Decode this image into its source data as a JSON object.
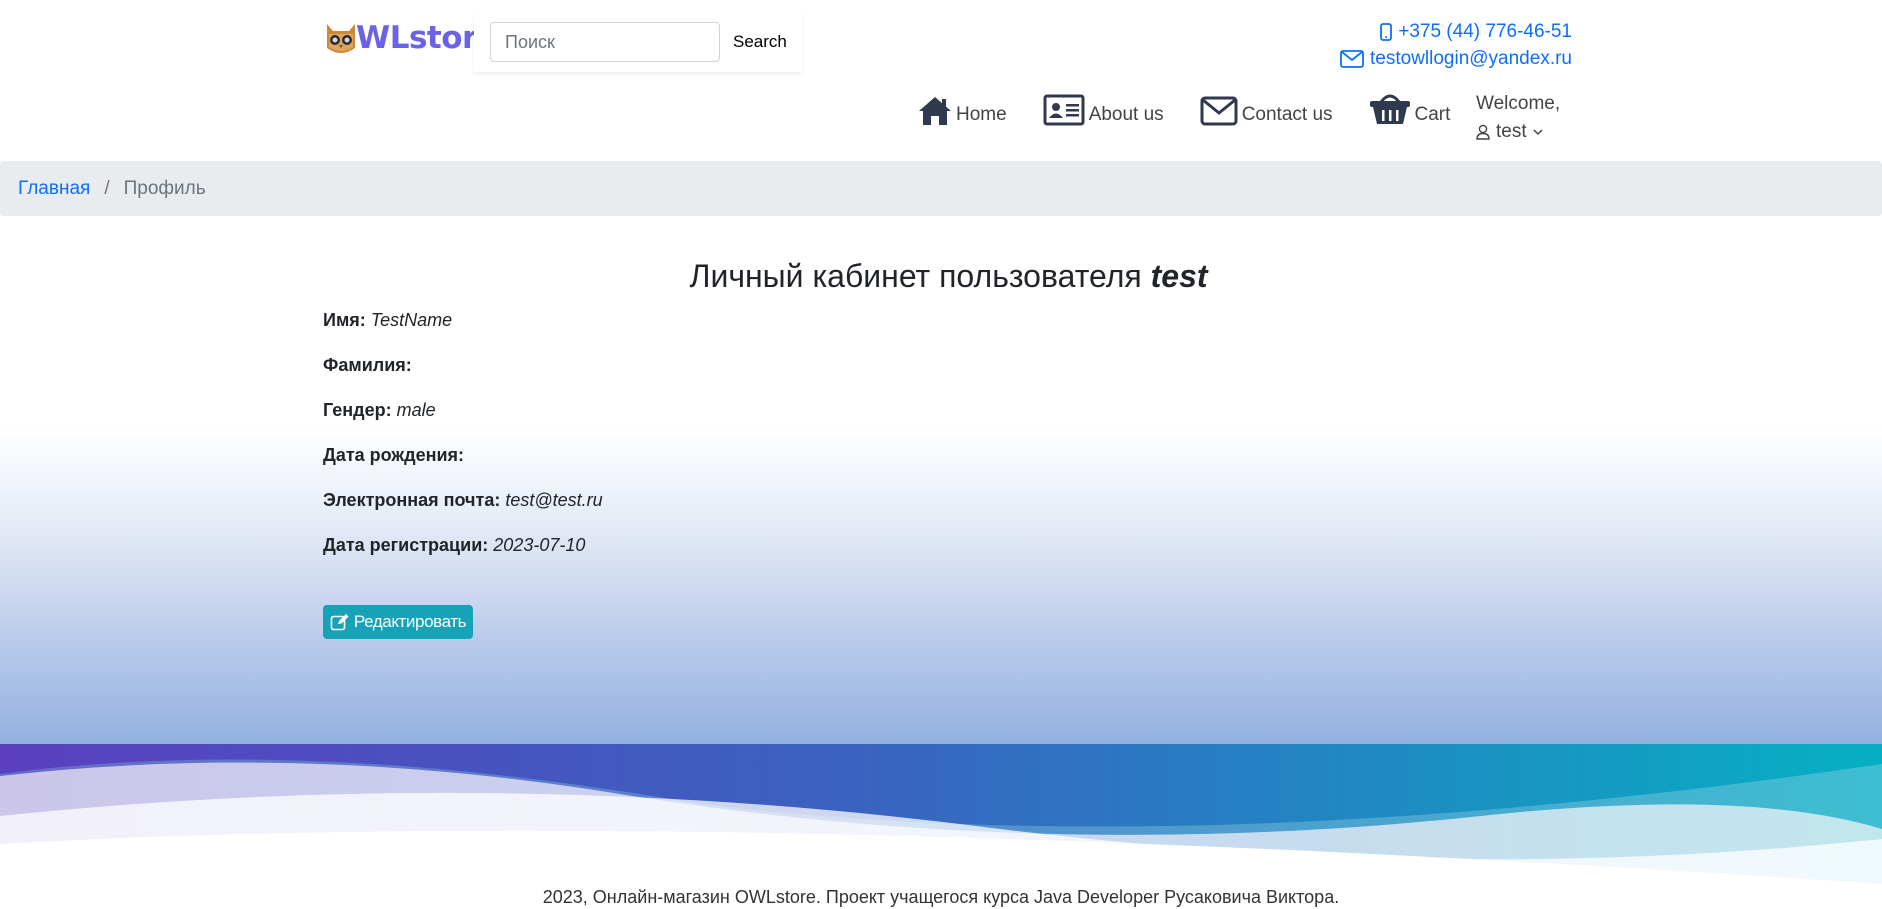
{
  "header": {
    "logo_text": "WLstore",
    "search": {
      "placeholder": "Поиск",
      "value": "",
      "button_label": "Search"
    },
    "contacts": {
      "phone": "+375 (44) 776-46-51",
      "email": "testowllogin@yandex.ru"
    },
    "nav": [
      {
        "label": "Home",
        "icon": "home-icon"
      },
      {
        "label": "About us",
        "icon": "id-card-icon"
      },
      {
        "label": "Contact us",
        "icon": "envelope-icon"
      },
      {
        "label": "Cart",
        "icon": "basket-icon"
      }
    ],
    "welcome": {
      "label": "Welcome,",
      "username": "test"
    }
  },
  "breadcrumb": {
    "home": "Главная",
    "separator": "/",
    "current": "Профиль"
  },
  "profile": {
    "title_prefix": "Личный кабинет пользователя",
    "username": "test",
    "fields": [
      {
        "label": "Имя:",
        "value": "TestName"
      },
      {
        "label": "Фамилия:",
        "value": ""
      },
      {
        "label": "Гендер:",
        "value": "male"
      },
      {
        "label": "Дата рождения:",
        "value": ""
      },
      {
        "label": "Электронная почта:",
        "value": "test@test.ru"
      },
      {
        "label": "Дата регистрации:",
        "value": "2023-07-10"
      }
    ],
    "edit_button": "Редактировать"
  },
  "footer": {
    "text": "2023, Онлайн-магазин OWLstore. Проект учащегося курса Java Developer Русаковича Виктора."
  },
  "colors": {
    "accent": "#0d6efd",
    "brand": "#6b63e6",
    "edit_button": "#17a2b8",
    "icon_dark": "#2f3a4f"
  }
}
